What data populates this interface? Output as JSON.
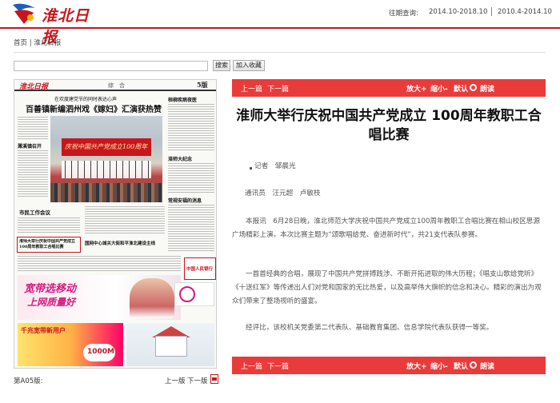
{
  "header": {
    "site_name": "淮北日报",
    "period_label": "往期查询:",
    "period_1": "2014.10-2018.10",
    "period_2": "2010.4-2014.10"
  },
  "breadcrumb": "首页 | 淮北日报",
  "search": {
    "input_value": "",
    "search_button": "搜索",
    "bookmark_button": "加入收藏"
  },
  "paper_page": {
    "masthead_logo": "淮北日报",
    "section": "综　合",
    "page_number": "5版",
    "headline_small": "在欢度建党节的同时表达心声",
    "headline_main": "百善镇新编泗州戏《嫁妇》汇演获热赞",
    "photo_banner": "庆祝中国共产党成立100周年",
    "side_head_1": "桓柳疾病夜医",
    "side_head_2": "淮师大纪念",
    "side_head_3": "常规安福的消息",
    "story_head_1": "濉溪镇召开",
    "story_head_2": "市民工作会议",
    "highlight_head": "淮师大举行庆祝中国共产党成立100周年教职工合唱比赛",
    "bottom_head": "国网中心城关大街和平淮北建设主线",
    "ad_bank": "中国人民银行",
    "ad_mobile_1": "宽带选移动",
    "ad_mobile_2": "上网质量好",
    "ad_bottom_title": "千兆宽带新用户",
    "ad_bottom_price": "1000M"
  },
  "paper_footer": {
    "page_label": "第A05版:",
    "prev": "上一版",
    "next": "下一版"
  },
  "toolbar": {
    "prev": "上一篇",
    "next": "下一篇",
    "zoom_in": "放大+",
    "zoom_out": "缩小-",
    "default": "默认",
    "read": "朗读"
  },
  "article": {
    "title": "淮师大举行庆祝中国共产党成立 100周年教职工合唱比赛",
    "reporter": "记者　邹晨光",
    "correspondents": "通讯员　汪元超　卢敏枝",
    "p1": "本报讯　6月28日晚，淮北师范大学庆祝中国共产党成立100周年教职工合唱比赛在相山校区思源广场精彩上演。本次比赛主题为“颂歌唱给党、奋进新时代”，共21支代表队参赛。",
    "p2": "一首首经典的合唱，展现了中国共产党拼搏践涉、不断开拓进取的伟大历程；《唱支山歌给党听》《十送红军》等传递出人们对党和国家的无比热爱，以及高举伟大旗帜的信念和决心。精彩的演出为观众们带来了整场视听的盛宴。",
    "p3": "经评比，该校机关党委第二代表队、基础教育集团、信息学院代表队获得一等奖。"
  }
}
